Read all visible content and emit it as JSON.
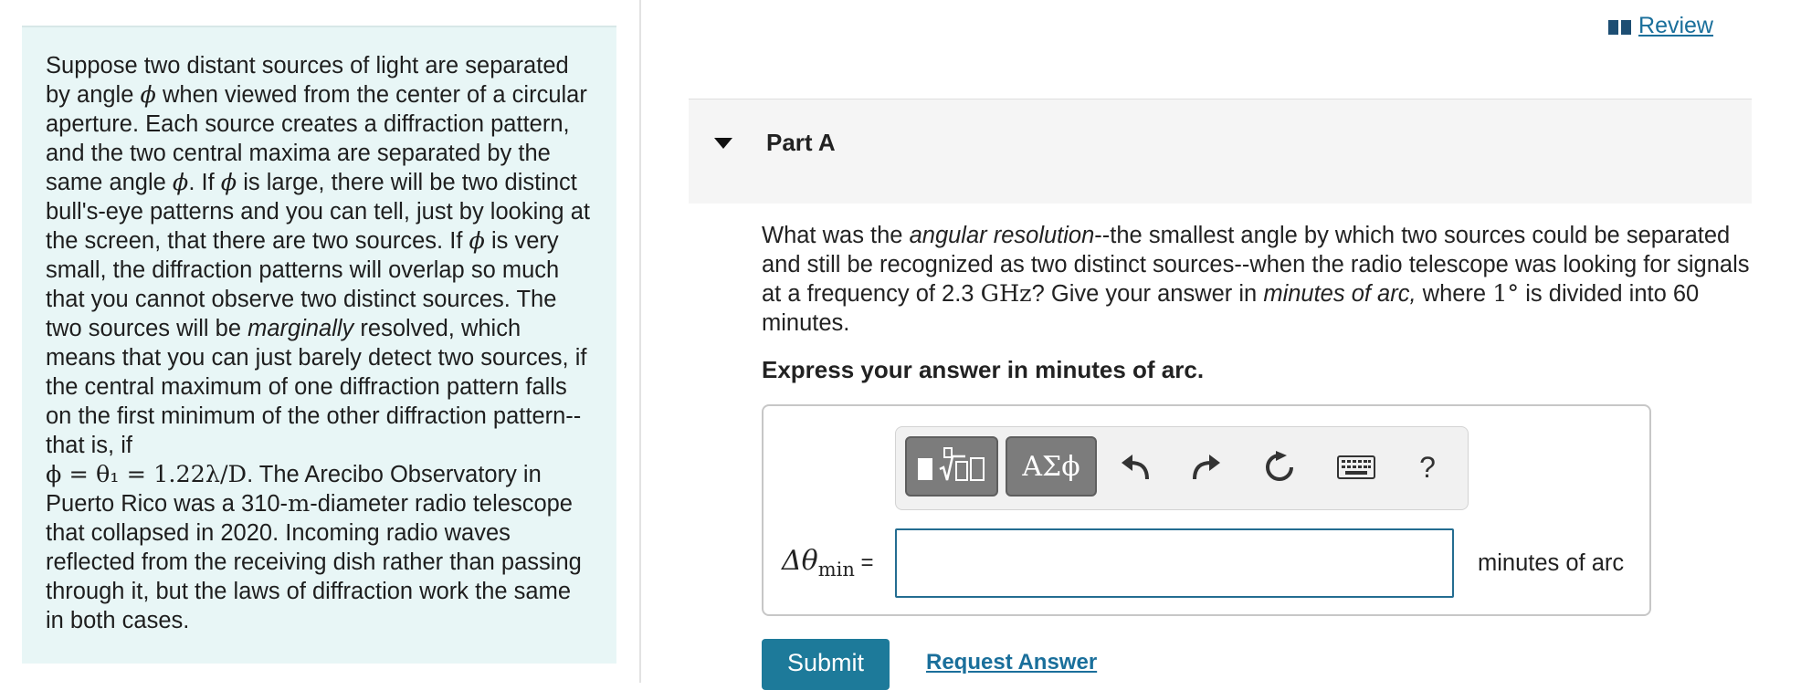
{
  "review": {
    "label": "Review",
    "icon": "book-icon"
  },
  "problem": {
    "t1": "Suppose two distant sources of light are separated by angle ",
    "phi": "ϕ",
    "t2": " when viewed from the center of a circular aperture. Each source creates a diffraction pattern, and the two central maxima are separated by the same angle ",
    "t3": ". If ",
    "t4": " is large, there will be two distinct bull's-eye patterns and you can tell, just by looking at the screen, that there are two sources. If ",
    "t5": " is very small, the diffraction patterns will overlap so much that you cannot observe two distinct sources. The two sources will be ",
    "marginally": "marginally",
    "t6": " resolved, which means that you can just barely detect two sources, if the central maximum of one diffraction pattern falls on the first minimum of the other diffraction pattern--that is, if",
    "formula": "ϕ = θ₁ = 1.22λ/D",
    "t7": ". The Arecibo Observatory in Puerto Rico was a 310-",
    "m": "m",
    "t8": "-diameter radio telescope that collapsed in 2020. Incoming radio waves reflected from the receiving dish rather than passing through it, but the laws of diffraction work the same in both cases."
  },
  "part": {
    "title": "Part A"
  },
  "question": {
    "q1": "What was the ",
    "q_em1": "angular resolution",
    "q2": "--the smallest angle by which two sources could be separated and still be recognized as two distinct sources--when the radio telescope was looking for signals at a frequency of 2.3 ",
    "ghz": "GHz",
    "q3": "? Give your answer in ",
    "q_em2": "minutes of arc,",
    "q4": " where ",
    "deg": "1°",
    "q5": " is divided into 60 minutes."
  },
  "express": "Express your answer in minutes of arc.",
  "toolbar": {
    "symbols_label": "ΑΣϕ",
    "help_label": "?",
    "icons": [
      "templates-icon",
      "undo-icon",
      "redo-icon",
      "reset-icon",
      "keyboard-icon",
      "help-icon"
    ]
  },
  "answer": {
    "label_main": "Δθ",
    "label_sub": "min",
    "label_eq": " =",
    "value": "",
    "units": "minutes of arc"
  },
  "buttons": {
    "submit": "Submit",
    "request": "Request Answer"
  },
  "colors": {
    "panel_bg": "#e8f6f6",
    "accent": "#1d7a9a",
    "link": "#1a6f9b"
  }
}
